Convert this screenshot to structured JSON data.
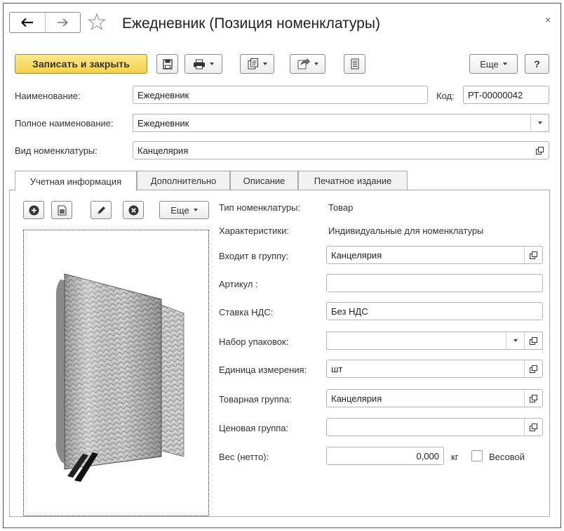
{
  "window": {
    "title": "Ежедневник (Позиция номенклатуры)",
    "close_glyph": "×"
  },
  "toolbar": {
    "save_close_label": "Записать и закрыть",
    "more_label": "Еще",
    "help_label": "?"
  },
  "header_fields": {
    "name_label": "Наименование:",
    "name_value": "Ежедневник",
    "code_label": "Код:",
    "code_value": "РТ-00000042",
    "full_name_label": "Полное наименование:",
    "full_name_value": "Ежедневник",
    "kind_label": "Вид номенклатуры:",
    "kind_value": "Канцелярия"
  },
  "tabs": [
    {
      "label": "Учетная информация",
      "active": true
    },
    {
      "label": "Дополнительно",
      "active": false
    },
    {
      "label": "Описание",
      "active": false
    },
    {
      "label": "Печатное издание",
      "active": false
    }
  ],
  "image_toolbar": {
    "more_label": "Еще"
  },
  "details": {
    "type_label": "Тип номенклатуры:",
    "type_value": "Товар",
    "chars_label": "Характеристики:",
    "chars_value": "Индивидуальные для номенклатуры",
    "group_label": "Входит в группу:",
    "group_value": "Канцелярия",
    "article_label": "Артикул :",
    "article_value": "",
    "vat_label": "Ставка НДС:",
    "vat_value": "Без НДС",
    "pack_label": "Набор упаковок:",
    "pack_value": "",
    "unit_label": "Единица измерения:",
    "unit_value": "шт",
    "goods_group_label": "Товарная группа:",
    "goods_group_value": "Канцелярия",
    "price_group_label": "Ценовая группа:",
    "price_group_value": "",
    "weight_label": "Вес (нетто):",
    "weight_value": "0,000",
    "weight_unit": "кг",
    "weighted_label": "Весовой",
    "weighted_checked": false
  },
  "colors": {
    "primary_button": "#f4d24c",
    "border": "#b3b3b3"
  },
  "icons": [
    "back-arrow-icon",
    "forward-arrow-icon",
    "star-icon",
    "save-icon",
    "print-icon",
    "copy-icon",
    "send-icon",
    "document-icon",
    "add-icon",
    "file-icon",
    "edit-icon",
    "delete-icon",
    "open-icon",
    "dropdown-icon"
  ]
}
